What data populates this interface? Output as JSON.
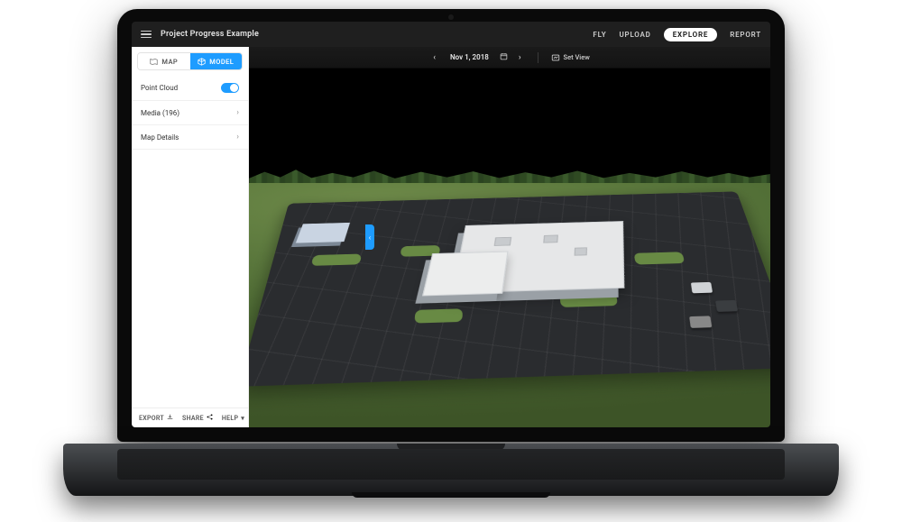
{
  "header": {
    "title": "Project Progress Example",
    "nav": {
      "fly": "FLY",
      "upload": "UPLOAD",
      "explore": "EXPLORE",
      "report": "REPORT",
      "active": "explore"
    }
  },
  "sidebar": {
    "tabs": {
      "map": "MAP",
      "model": "MODEL",
      "active": "model"
    },
    "point_cloud": {
      "label": "Point Cloud",
      "on": true
    },
    "media": {
      "label": "Media (196)",
      "count": 196
    },
    "map_details": {
      "label": "Map Details"
    },
    "footer": {
      "export": "EXPORT",
      "share": "SHARE",
      "help": "HELP"
    }
  },
  "mainbar": {
    "date": "Nov 1, 2018",
    "set_view": "Set View"
  },
  "colors": {
    "accent": "#1e9cff",
    "topbar": "#1f1f1f",
    "nav_pill_bg": "#ffffff"
  }
}
